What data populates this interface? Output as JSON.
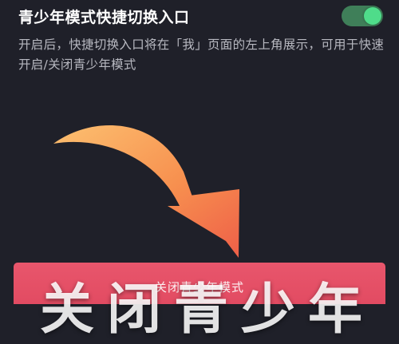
{
  "setting": {
    "title": "青少年模式快捷切换入口",
    "toggle_state": "on",
    "description": "开启后，快捷切换入口将在「我」页面的左上角展示，可用于快速开启/关闭青少年模式"
  },
  "banner": {
    "label": "关闭青少年模式"
  },
  "caption": {
    "text": "关闭青少年"
  },
  "colors": {
    "background": "#1f2029",
    "toggle_track": "#3f7f59",
    "toggle_knob": "#4fdc8a",
    "banner": "#e24b62",
    "arrow_light": "#fbb86a",
    "arrow_dark": "#f26a4a"
  },
  "icons": {
    "arrow": "curved-arrow-icon"
  }
}
